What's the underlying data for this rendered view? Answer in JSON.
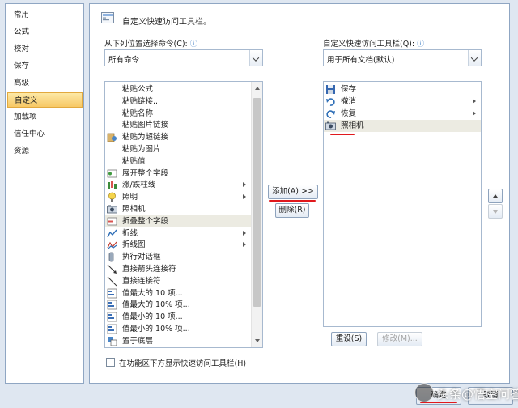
{
  "nav": {
    "items": [
      {
        "label": "常用"
      },
      {
        "label": "公式"
      },
      {
        "label": "校对"
      },
      {
        "label": "保存"
      },
      {
        "label": "高级"
      },
      {
        "label": "自定义"
      },
      {
        "label": "加载项"
      },
      {
        "label": "信任中心"
      },
      {
        "label": "资源"
      }
    ],
    "active_index": 5
  },
  "header": {
    "title": "自定义快速访问工具栏。"
  },
  "left": {
    "label": "从下列位置选择命令(C):",
    "info_icon": "ⓘ",
    "combo_value": "所有命令",
    "commands": [
      {
        "label": "粘贴公式",
        "icon": "none"
      },
      {
        "label": "粘贴链接...",
        "icon": "none"
      },
      {
        "label": "粘贴名称",
        "icon": "none"
      },
      {
        "label": "粘贴图片链接",
        "icon": "none"
      },
      {
        "label": "粘贴为超链接",
        "icon": "paste-hyperlink-icon"
      },
      {
        "label": "粘贴为图片",
        "icon": "none"
      },
      {
        "label": "粘贴值",
        "icon": "none"
      },
      {
        "label": "展开整个字段",
        "icon": "expand-field-icon"
      },
      {
        "label": "涨/跌柱线",
        "icon": "updown-bars-icon",
        "submenu": true
      },
      {
        "label": "照明",
        "icon": "lighting-icon",
        "submenu": true
      },
      {
        "label": "照相机",
        "icon": "camera-icon"
      },
      {
        "label": "折叠整个字段",
        "icon": "collapse-field-icon",
        "selected": true
      },
      {
        "label": "折线",
        "icon": "line-chart-icon",
        "submenu": true
      },
      {
        "label": "折线图",
        "icon": "line-chart-2-icon",
        "submenu": true
      },
      {
        "label": "执行对话框",
        "icon": "run-dialog-icon"
      },
      {
        "label": "直接箭头连接符",
        "icon": "arrow-connector-icon"
      },
      {
        "label": "直接连接符",
        "icon": "straight-connector-icon"
      },
      {
        "label": "值最大的 10 项...",
        "icon": "top10-icon"
      },
      {
        "label": "值最大的 10% 项...",
        "icon": "top10pct-icon"
      },
      {
        "label": "值最小的 10 项...",
        "icon": "bottom10-icon"
      },
      {
        "label": "值最小的 10% 项...",
        "icon": "bottom10pct-icon"
      },
      {
        "label": "置于底层",
        "icon": "send-back-icon"
      }
    ]
  },
  "right": {
    "label": "自定义快速访问工具栏(Q):",
    "info_icon": "ⓘ",
    "combo_value": "用于所有文档(默认)",
    "items": [
      {
        "label": "保存",
        "icon": "save-icon"
      },
      {
        "label": "撤消",
        "icon": "undo-icon",
        "submenu": true
      },
      {
        "label": "恢复",
        "icon": "redo-icon",
        "submenu": true
      },
      {
        "label": "照相机",
        "icon": "camera-icon",
        "selected": true
      }
    ]
  },
  "buttons": {
    "add": "添加(A) >>",
    "remove": "删除(R)",
    "reset": "重设(S)",
    "modify": "修改(M)...",
    "ok": "确定",
    "cancel": "取消"
  },
  "checkbox": {
    "label": "在功能区下方显示快速访问工具栏(H)",
    "checked": false
  },
  "watermark": {
    "text": "头条@悟空问答"
  },
  "colors": {
    "accent": "#f7c865",
    "annotation_red": "#e0191d",
    "panel_border": "#8fa6c3"
  }
}
